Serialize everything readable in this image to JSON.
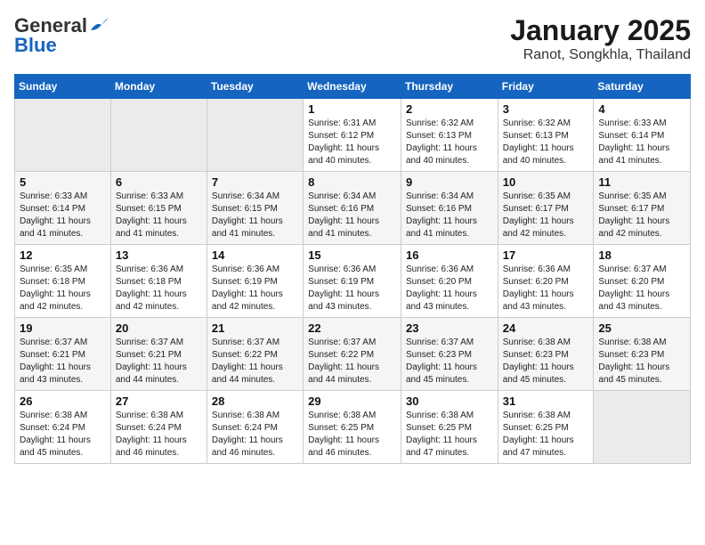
{
  "header": {
    "logo_line1": "General",
    "logo_line2": "Blue",
    "month_year": "January 2025",
    "location": "Ranot, Songkhla, Thailand"
  },
  "weekdays": [
    "Sunday",
    "Monday",
    "Tuesday",
    "Wednesday",
    "Thursday",
    "Friday",
    "Saturday"
  ],
  "weeks": [
    [
      {
        "day": "",
        "info": ""
      },
      {
        "day": "",
        "info": ""
      },
      {
        "day": "",
        "info": ""
      },
      {
        "day": "1",
        "info": "Sunrise: 6:31 AM\nSunset: 6:12 PM\nDaylight: 11 hours and 40 minutes."
      },
      {
        "day": "2",
        "info": "Sunrise: 6:32 AM\nSunset: 6:13 PM\nDaylight: 11 hours and 40 minutes."
      },
      {
        "day": "3",
        "info": "Sunrise: 6:32 AM\nSunset: 6:13 PM\nDaylight: 11 hours and 40 minutes."
      },
      {
        "day": "4",
        "info": "Sunrise: 6:33 AM\nSunset: 6:14 PM\nDaylight: 11 hours and 41 minutes."
      }
    ],
    [
      {
        "day": "5",
        "info": "Sunrise: 6:33 AM\nSunset: 6:14 PM\nDaylight: 11 hours and 41 minutes."
      },
      {
        "day": "6",
        "info": "Sunrise: 6:33 AM\nSunset: 6:15 PM\nDaylight: 11 hours and 41 minutes."
      },
      {
        "day": "7",
        "info": "Sunrise: 6:34 AM\nSunset: 6:15 PM\nDaylight: 11 hours and 41 minutes."
      },
      {
        "day": "8",
        "info": "Sunrise: 6:34 AM\nSunset: 6:16 PM\nDaylight: 11 hours and 41 minutes."
      },
      {
        "day": "9",
        "info": "Sunrise: 6:34 AM\nSunset: 6:16 PM\nDaylight: 11 hours and 41 minutes."
      },
      {
        "day": "10",
        "info": "Sunrise: 6:35 AM\nSunset: 6:17 PM\nDaylight: 11 hours and 42 minutes."
      },
      {
        "day": "11",
        "info": "Sunrise: 6:35 AM\nSunset: 6:17 PM\nDaylight: 11 hours and 42 minutes."
      }
    ],
    [
      {
        "day": "12",
        "info": "Sunrise: 6:35 AM\nSunset: 6:18 PM\nDaylight: 11 hours and 42 minutes."
      },
      {
        "day": "13",
        "info": "Sunrise: 6:36 AM\nSunset: 6:18 PM\nDaylight: 11 hours and 42 minutes."
      },
      {
        "day": "14",
        "info": "Sunrise: 6:36 AM\nSunset: 6:19 PM\nDaylight: 11 hours and 42 minutes."
      },
      {
        "day": "15",
        "info": "Sunrise: 6:36 AM\nSunset: 6:19 PM\nDaylight: 11 hours and 43 minutes."
      },
      {
        "day": "16",
        "info": "Sunrise: 6:36 AM\nSunset: 6:20 PM\nDaylight: 11 hours and 43 minutes."
      },
      {
        "day": "17",
        "info": "Sunrise: 6:36 AM\nSunset: 6:20 PM\nDaylight: 11 hours and 43 minutes."
      },
      {
        "day": "18",
        "info": "Sunrise: 6:37 AM\nSunset: 6:20 PM\nDaylight: 11 hours and 43 minutes."
      }
    ],
    [
      {
        "day": "19",
        "info": "Sunrise: 6:37 AM\nSunset: 6:21 PM\nDaylight: 11 hours and 43 minutes."
      },
      {
        "day": "20",
        "info": "Sunrise: 6:37 AM\nSunset: 6:21 PM\nDaylight: 11 hours and 44 minutes."
      },
      {
        "day": "21",
        "info": "Sunrise: 6:37 AM\nSunset: 6:22 PM\nDaylight: 11 hours and 44 minutes."
      },
      {
        "day": "22",
        "info": "Sunrise: 6:37 AM\nSunset: 6:22 PM\nDaylight: 11 hours and 44 minutes."
      },
      {
        "day": "23",
        "info": "Sunrise: 6:37 AM\nSunset: 6:23 PM\nDaylight: 11 hours and 45 minutes."
      },
      {
        "day": "24",
        "info": "Sunrise: 6:38 AM\nSunset: 6:23 PM\nDaylight: 11 hours and 45 minutes."
      },
      {
        "day": "25",
        "info": "Sunrise: 6:38 AM\nSunset: 6:23 PM\nDaylight: 11 hours and 45 minutes."
      }
    ],
    [
      {
        "day": "26",
        "info": "Sunrise: 6:38 AM\nSunset: 6:24 PM\nDaylight: 11 hours and 45 minutes."
      },
      {
        "day": "27",
        "info": "Sunrise: 6:38 AM\nSunset: 6:24 PM\nDaylight: 11 hours and 46 minutes."
      },
      {
        "day": "28",
        "info": "Sunrise: 6:38 AM\nSunset: 6:24 PM\nDaylight: 11 hours and 46 minutes."
      },
      {
        "day": "29",
        "info": "Sunrise: 6:38 AM\nSunset: 6:25 PM\nDaylight: 11 hours and 46 minutes."
      },
      {
        "day": "30",
        "info": "Sunrise: 6:38 AM\nSunset: 6:25 PM\nDaylight: 11 hours and 47 minutes."
      },
      {
        "day": "31",
        "info": "Sunrise: 6:38 AM\nSunset: 6:25 PM\nDaylight: 11 hours and 47 minutes."
      },
      {
        "day": "",
        "info": ""
      }
    ]
  ]
}
